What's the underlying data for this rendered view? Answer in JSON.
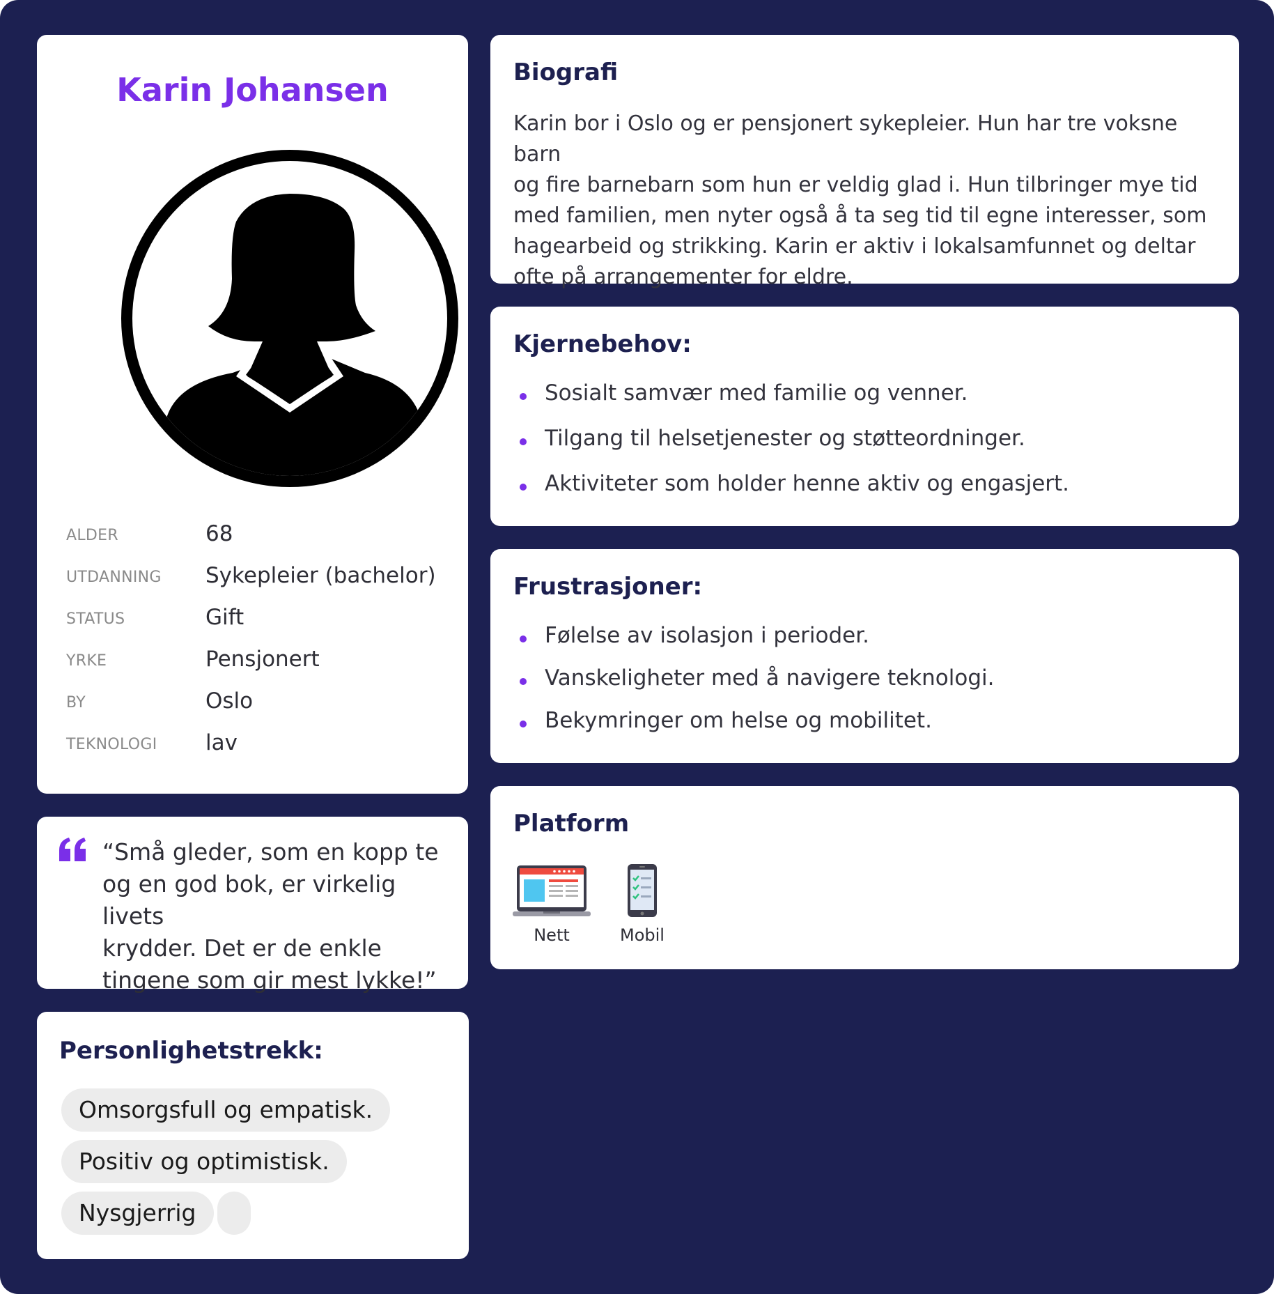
{
  "profile": {
    "name": "Karin Johansen",
    "info": [
      {
        "label": "ALDER",
        "value": "68"
      },
      {
        "label": "UTDANNING",
        "value": "Sykepleier (bachelor)"
      },
      {
        "label": "STATUS",
        "value": "Gift"
      },
      {
        "label": "YRKE",
        "value": "Pensjonert"
      },
      {
        "label": "BY",
        "value": "Oslo"
      },
      {
        "label": "TEKNOLOGI",
        "value": "lav"
      }
    ]
  },
  "quote": {
    "lines": [
      "“Små gleder, som en kopp te",
      "og en god bok, er virkelig livets",
      "krydder. Det er de enkle",
      "tingene som gir mest lykke!”"
    ]
  },
  "traits": {
    "title": "Personlighetstrekk:",
    "items": [
      "Omsorgsfull og empatisk.",
      "Positiv og optimistisk.",
      "Nysgjerrig",
      ""
    ]
  },
  "bio": {
    "title": "Biografi",
    "lines": [
      "Karin bor i Oslo og er pensjonert sykepleier. Hun har tre voksne barn",
      "og fire barnebarn som hun er veldig glad i. Hun tilbringer mye tid",
      "med familien, men nyter også å ta seg tid til egne interesser, som",
      "hagearbeid og strikking. Karin er aktiv i lokalsamfunnet og deltar",
      "ofte på arrangementer for eldre."
    ]
  },
  "needs": {
    "title": "Kjernebehov:",
    "items": [
      "Sosialt samvær med familie og venner.",
      "Tilgang til helsetjenester og støtteordninger.",
      "Aktiviteter som holder henne aktiv og engasjert."
    ]
  },
  "frustrations": {
    "title": "Frustrasjoner:",
    "items": [
      "Følelse av isolasjon i perioder.",
      "Vanskeligheter med å navigere teknologi.",
      "Bekymringer om helse og mobilitet."
    ]
  },
  "platform": {
    "title": "Platform",
    "items": [
      {
        "label": "Nett",
        "icon": "laptop-icon"
      },
      {
        "label": "Mobil",
        "icon": "smartphone-icon"
      }
    ]
  },
  "colors": {
    "background": "#1c2051",
    "accent": "#7a2fe8",
    "heading": "#1d2050",
    "chip": "#ececec"
  }
}
